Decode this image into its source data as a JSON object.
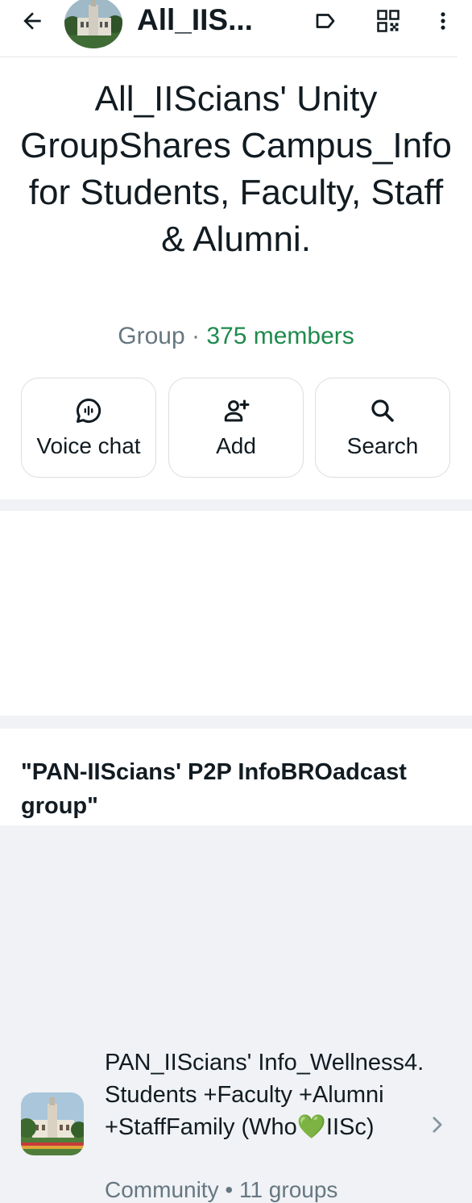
{
  "appbar": {
    "short_title": "All_IIS...",
    "icons": [
      "arrow-left-icon",
      "label-icon",
      "qr-code-icon",
      "more-vert-icon"
    ]
  },
  "group": {
    "name": "All_IIScians' Unity GroupShares Campus_Info for Students, Faculty, Staff & Alumni.",
    "type": "Group",
    "separator": "·",
    "members": "375 members"
  },
  "actions": [
    {
      "label": "Voice chat",
      "icon": "voice-chat-icon"
    },
    {
      "label": "Add",
      "icon": "add-person-icon"
    },
    {
      "label": "Search",
      "icon": "search-icon"
    }
  ],
  "community": {
    "name": "PAN_IIScians' Info_Wellness4. Students +Faculty +Alumni +StaffFamily (Who💚IISc)",
    "meta": "Community • 11 groups"
  },
  "description": {
    "text": "\"PAN-IIScians' P2P InfoBROadcast group\""
  },
  "colors": {
    "accent_green": "#1f8a4c",
    "secondary_text": "#667781",
    "background": "#f0f2f5"
  }
}
